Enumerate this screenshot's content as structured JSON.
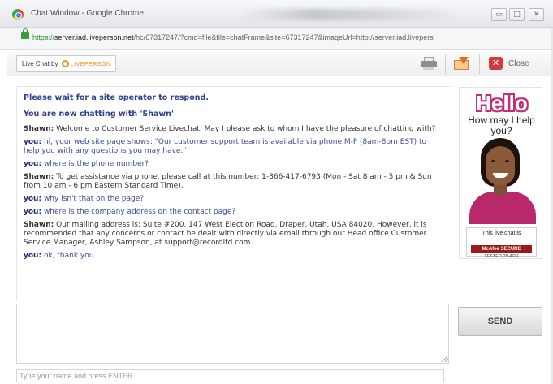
{
  "window": {
    "title": "Chat Window - Google Chrome",
    "min_glyph": "▭",
    "max_glyph": "□",
    "close_glyph": "✕"
  },
  "address_bar": {
    "scheme": "https://",
    "host": "server.iad.liveperson.net",
    "path": "/hc/67317247/?cmd=file&file=chatFrame&site=67317247&imageUrl=http://server.iad.livepers"
  },
  "toolbar": {
    "brand_prefix": "Live Chat by",
    "brand_name": "LIVEPERSON",
    "close_label": "Close"
  },
  "transcript": {
    "system": [
      "Please wait for a site operator to respond.",
      "You are now chatting with 'Shawn'"
    ],
    "messages": [
      {
        "speaker": "Shawn:",
        "text": "Welcome to Customer Service Livechat.  May I please ask to whom I have the pleasure of chatting with?"
      },
      {
        "speaker": "you:",
        "text": "hi, your web site page shows: \"Our customer support team is available via phone M-F (8am-8pm EST) to help you with any questions you may have.\""
      },
      {
        "speaker": "you:",
        "text": "where is the phone number?"
      },
      {
        "speaker": "Shawn:",
        "text": "To get assistance via phone, please call at this number: 1-866-417-6793 (Mon - Sat 8 am - 5 pm & Sun from 10 am - 6 pm Eastern Standard Time)."
      },
      {
        "speaker": "you:",
        "text": "why isn't that on the page?"
      },
      {
        "speaker": "you:",
        "text": "where is the company address on the contact page?"
      },
      {
        "speaker": "Shawn:",
        "text": "Our mailing address is: Suite #200, 147 West Election Road, Draper, Utah, USA 84020.  However, it is recommended that any concerns or contact be dealt with directly via email through our Head office Customer Service Manager, Ashley Sampson, at support@recordltd.com."
      },
      {
        "speaker": "you:",
        "text": "ok, thank you"
      }
    ]
  },
  "ad": {
    "hello": "Hello",
    "tagline": "How may I help you?",
    "badge_caption": "This live chat is",
    "badge_brand": "McAfee SECURE",
    "badge_tested": "TESTED      28-APR"
  },
  "composer": {
    "send_label": "SEND",
    "name_placeholder": "Type your name and press ENTER"
  },
  "colors": {
    "system_text": "#2f3d8f",
    "visitor_text": "#3a4aa0",
    "hello_pink": "#c2307a",
    "liveperson_orange": "#f28a1c",
    "close_red": "#d23b3b"
  }
}
